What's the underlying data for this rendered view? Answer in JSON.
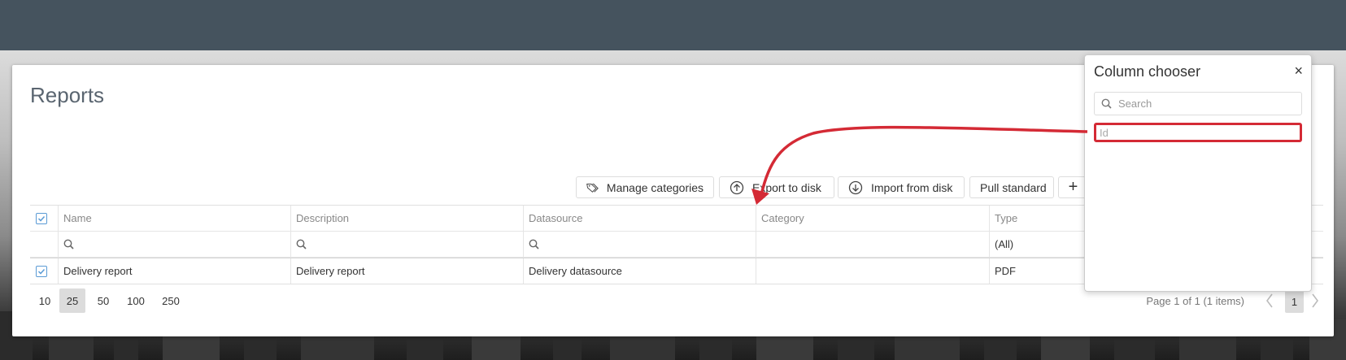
{
  "page": {
    "title": "Reports"
  },
  "toolbar": {
    "manage_categories": "Manage categories",
    "export_to_disk": "Export to disk",
    "import_from_disk": "Import from disk",
    "pull_standard": "Pull standard",
    "add": "+"
  },
  "grid": {
    "columns": [
      "Name",
      "Description",
      "Datasource",
      "Category",
      "Type"
    ],
    "filter": {
      "type_value": "(All)"
    },
    "rows": [
      {
        "name": "Delivery report",
        "description": "Delivery report",
        "datasource": "Delivery datasource",
        "category": "",
        "type": "PDF"
      }
    ]
  },
  "pager": {
    "sizes": [
      "10",
      "25",
      "50",
      "100",
      "250"
    ],
    "selected_size": "25",
    "info": "Page 1 of 1 (1 items)",
    "current_page": "1"
  },
  "column_chooser": {
    "title": "Column chooser",
    "close": "×",
    "search_placeholder": "Search",
    "items": [
      "Id"
    ]
  },
  "colors": {
    "topbar": "#45535e",
    "annotation": "#d42a35",
    "accent": "#5b9bd5"
  }
}
